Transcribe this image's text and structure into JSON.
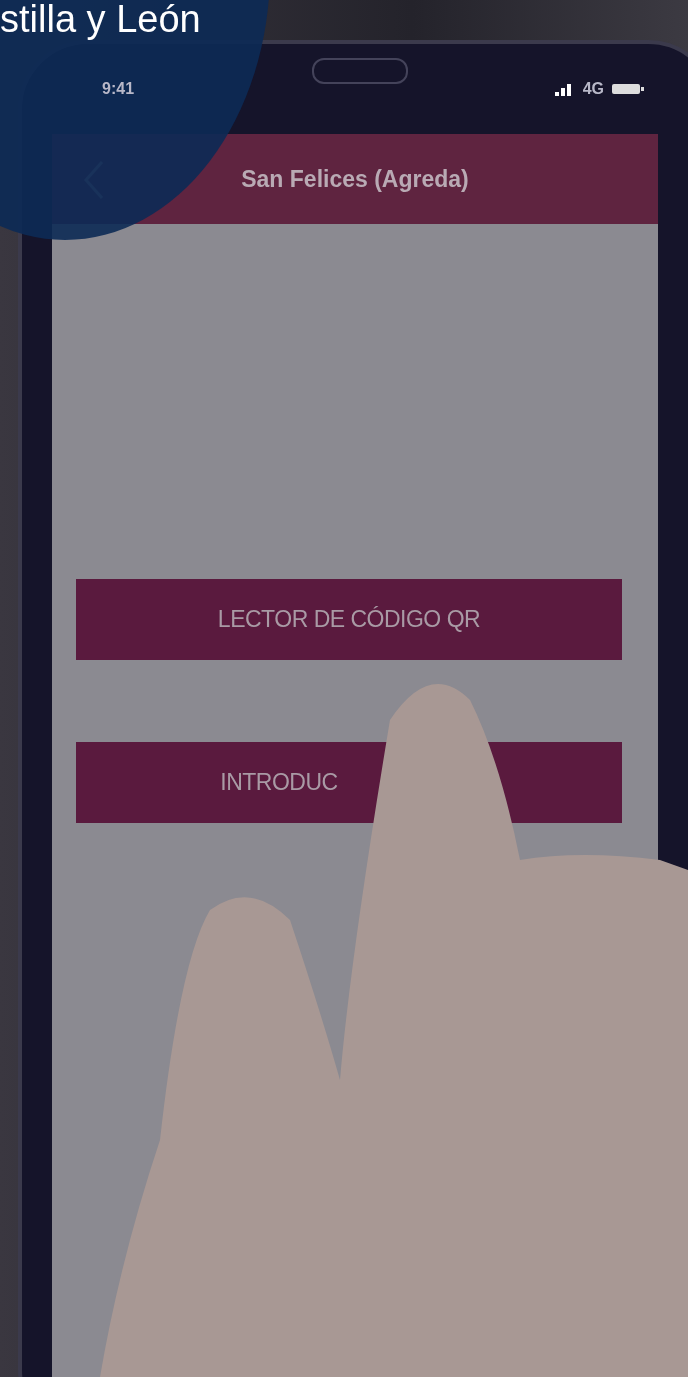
{
  "headline": "stilla y León",
  "status_bar": {
    "time": "9:41",
    "network": "4G"
  },
  "app_bar": {
    "title": "San Felices (Agreda)"
  },
  "buttons": [
    {
      "label": "LECTOR DE CÓDIGO QR"
    },
    {
      "label": "INTRODUC"
    }
  ]
}
